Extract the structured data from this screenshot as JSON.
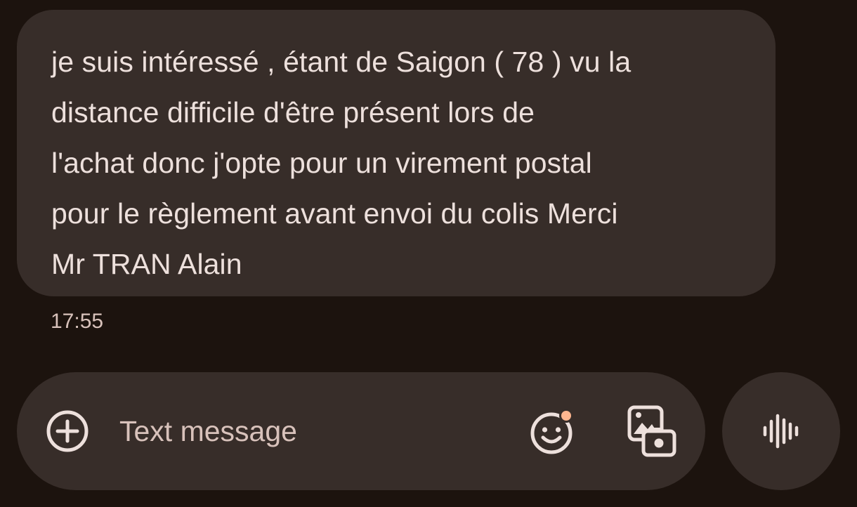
{
  "conversation": {
    "message": {
      "text": "je suis intéressé , étant de Saigon ( 78 ) vu la\ndistance difficile d'être présent lors de\nl'achat donc j'opte pour un virement postal\npour le règlement avant envoi du colis Merci\nMr TRAN Alain",
      "time": "17:55"
    }
  },
  "composer": {
    "placeholder": "Text message",
    "value": "",
    "icons": {
      "add": "add-circle-icon",
      "emoji": "emoji-icon",
      "gallery": "gallery-icon",
      "voice": "voice-waveform-icon"
    }
  },
  "colors": {
    "background": "#1c130e",
    "bubble": "#372d29",
    "text": "#ede0dc",
    "secondary_text": "#d8c2bb",
    "badge": "#ffb68f"
  }
}
